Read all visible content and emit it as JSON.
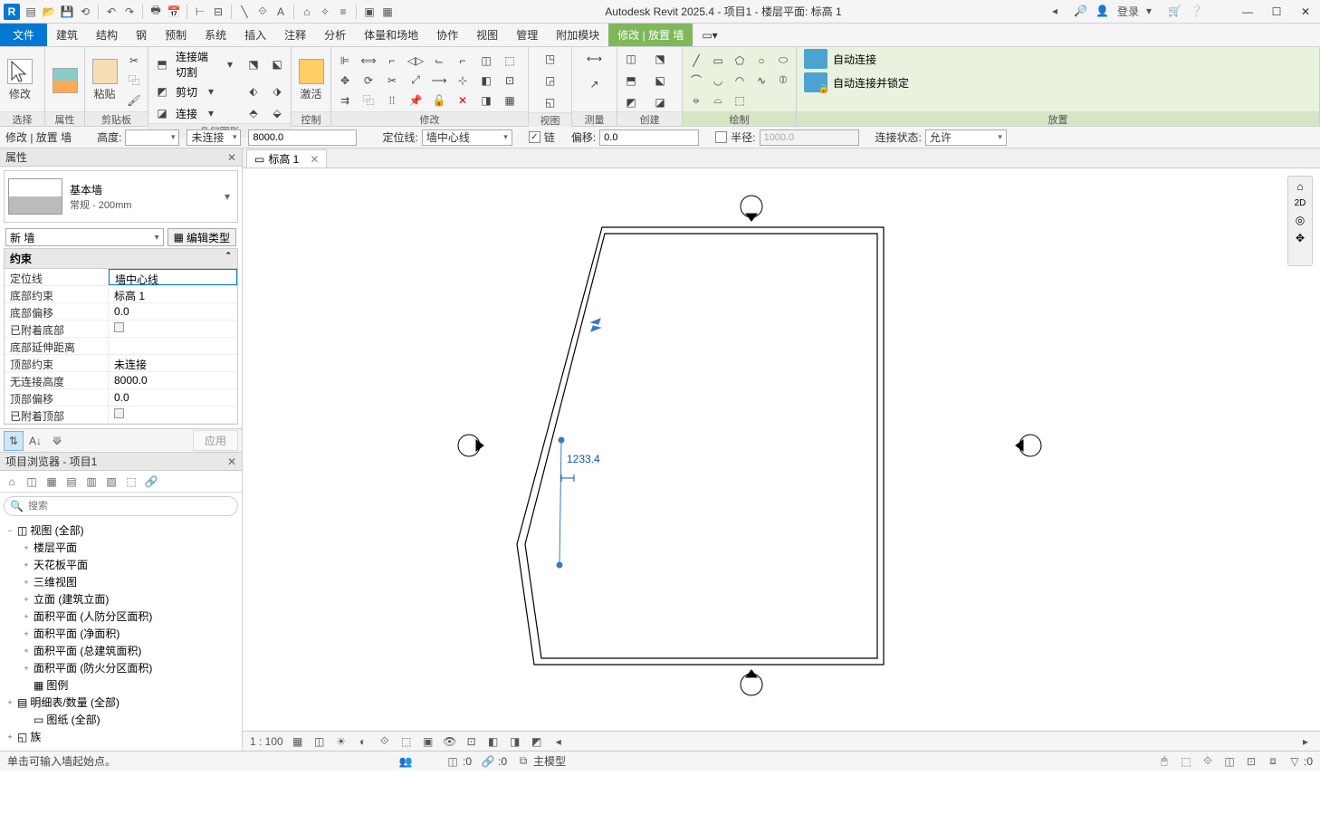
{
  "app_title": "Autodesk Revit 2025.4 - 项目1 - 楼层平面: 标高 1",
  "login": "登录",
  "menu": {
    "file": "文件",
    "tabs": [
      "建筑",
      "结构",
      "钢",
      "预制",
      "系统",
      "插入",
      "注释",
      "分析",
      "体量和场地",
      "协作",
      "视图",
      "管理",
      "附加模块"
    ],
    "mod": "修改 | 放置 墙"
  },
  "ribbon": {
    "select": "选择",
    "select_btn": "修改",
    "props": "属性",
    "clip": "剪贴板",
    "paste": "粘贴",
    "geom": "几何图形",
    "geom_items": [
      "连接端切割",
      "剪切",
      "连接"
    ],
    "ctrl": "控制",
    "ctrl_btn": "激活",
    "modify": "修改",
    "view": "视图",
    "measure": "测量",
    "create": "创建",
    "draw": "绘制",
    "place": "放置",
    "pl1": "自动连接",
    "pl2": "自动连接并锁定"
  },
  "opt": {
    "ctx": "修改 | 放置 墙",
    "height": "高度:",
    "unconn": "未连接",
    "hval": "8000.0",
    "loc": "定位线:",
    "locv": "墙中心线",
    "chain": "链",
    "offset": "偏移:",
    "offv": "0.0",
    "radius": "半径:",
    "radv": "1000.0",
    "connst": "连接状态:",
    "connv": "允许"
  },
  "props": {
    "title": "属性",
    "type_name": "基本墙",
    "type_sub": "常规 - 200mm",
    "new": "新 墙",
    "edit_type": "编辑类型",
    "grp": "约束",
    "rows": [
      {
        "k": "定位线",
        "v": "墙中心线",
        "sel": true
      },
      {
        "k": "底部约束",
        "v": "标高 1"
      },
      {
        "k": "底部偏移",
        "v": "0.0"
      },
      {
        "k": "已附着底部",
        "chk": true,
        "dis": true
      },
      {
        "k": "底部延伸距离",
        "v": "",
        "dis": true
      },
      {
        "k": "顶部约束",
        "v": "未连接"
      },
      {
        "k": "无连接高度",
        "v": "8000.0"
      },
      {
        "k": "顶部偏移",
        "v": "0.0"
      },
      {
        "k": "已附着顶部",
        "chk": true,
        "dis": true
      }
    ],
    "apply": "应用"
  },
  "browser": {
    "title": "项目浏览器 - 项目1",
    "search": "搜索",
    "root": "视图 (全部)",
    "nodes": [
      "楼层平面",
      "天花板平面",
      "三维视图",
      "立面 (建筑立面)",
      "面积平面 (人防分区面积)",
      "面积平面 (净面积)",
      "面积平面 (总建筑面积)",
      "面积平面 (防火分区面积)"
    ],
    "legend": "图例",
    "sched": "明细表/数量 (全部)",
    "sheets": "图纸 (全部)",
    "fam": "族"
  },
  "viewtab": "标高 1",
  "dim": "1233.4",
  "scale": "1 : 100",
  "status": {
    "hint": "单击可输入墙起始点。",
    "main": "主模型",
    "c0": ":0",
    "c1": ":0",
    "c2": ":0"
  }
}
